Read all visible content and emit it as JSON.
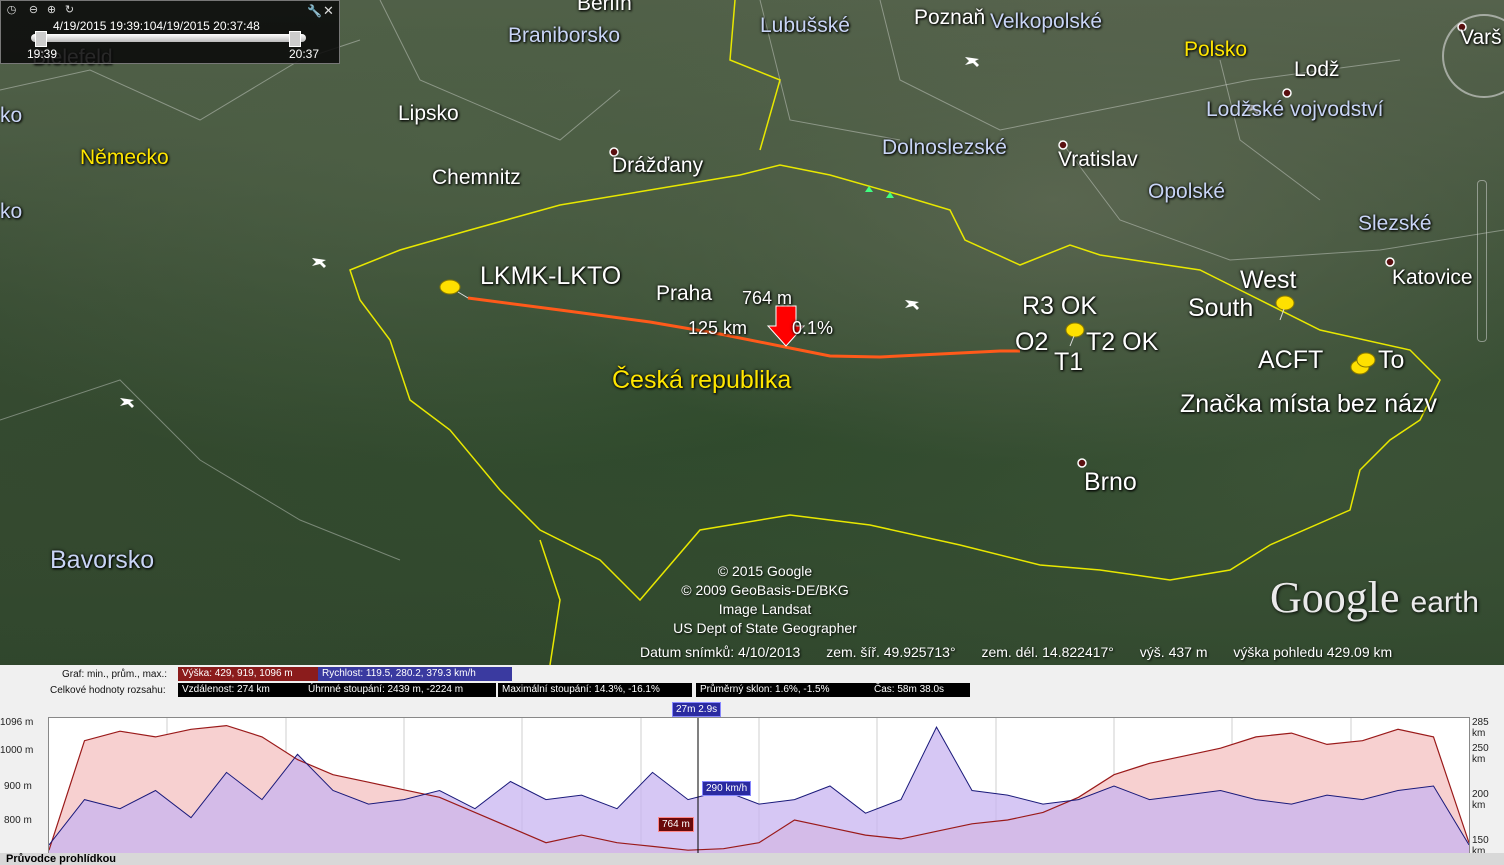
{
  "time_slider": {
    "range_label": "4/19/2015   19:39:104/19/2015   20:37:48",
    "start_time": "19:39",
    "end_time": "20:37"
  },
  "map": {
    "regions": [
      "Braniborsko",
      "Lubušské",
      "Velkopolské",
      "Dolnoslezské",
      "Opolské",
      "Lodžské vojvodství",
      "Slezské",
      "Bavorsko"
    ],
    "cities": [
      "Berlín",
      "Poznaň",
      "Lodž",
      "Varš",
      "Bielefeld",
      "Lipsko",
      "Chemnitz",
      "Drážďany",
      "Vratislav",
      "Katovice",
      "Brno",
      "Praha",
      "ko",
      "ko"
    ],
    "countries": [
      "Německo",
      "Polsko",
      "Česká republika"
    ],
    "placemarks": [
      "LKMK-LKTO",
      "R3 OK",
      "O2",
      "T1",
      "T2 OK",
      "West",
      "South",
      "ACFT",
      "To",
      "Značka místa bez názv"
    ],
    "cursor": {
      "elevation": "764 m",
      "distance": "125 km",
      "slope": "0.1%"
    },
    "attribution": [
      "© 2015 Google",
      "© 2009 GeoBasis-DE/BKG",
      "Image Landsat",
      "US Dept of State Geographer"
    ],
    "logo": {
      "google": "Google",
      "earth": "earth"
    },
    "status": {
      "imagery_date": "Datum snímků: 4/10/2013",
      "lat": "zem. šíř.   49.925713°",
      "lon": "zem. dél.   14.822417°",
      "elev": "výš.   437 m",
      "eye_alt": "výška pohledu 429.09 km"
    }
  },
  "profile": {
    "graph_label": "Graf: min., prům., max.:",
    "elevation_stats": "Výška: 429, 919, 1096 m",
    "speed_stats": "Rychlost: 119.5, 280.2, 379.3 km/h",
    "totals_label": "Celkové hodnoty rozsahu:",
    "distance": "Vzdálenost: 274 km",
    "total_climb": "Úhrnné stoupání: 2439 m, -2224 m",
    "max_slope": "Maximální stoupání: 14.3%, -16.1%",
    "avg_slope": "Průměrný sklon: 1.6%, -1.5%",
    "time": "Čas: 58m 38.0s",
    "cursor_time": "27m 2.9s",
    "cursor_speed": "290 km/h",
    "cursor_elev": "764 m",
    "y_left": [
      "1096 m",
      "1000 m",
      "900 m",
      "800 m"
    ],
    "y_right": [
      "285 km",
      "250 km",
      "200 km",
      "150 km"
    ],
    "guide_title": "Průvodce prohlídkou"
  },
  "colors": {
    "track": "#ff5a1a",
    "border": "#e8e800",
    "elevation_fill": "#f7d0d0",
    "elevation_line": "#9a1a1a",
    "speed_fill": "#d8c8f0",
    "speed_line": "#1a1a7a"
  },
  "chart_data": {
    "type": "area",
    "x_range": [
      0,
      274
    ],
    "series": [
      {
        "name": "Výška",
        "unit": "m",
        "ylim": [
          750,
          1110
        ],
        "values": [
          760,
          1050,
          1075,
          1060,
          1080,
          1090,
          1060,
          1000,
          960,
          940,
          920,
          900,
          860,
          820,
          780,
          800,
          780,
          770,
          760,
          764,
          780,
          840,
          820,
          800,
          790,
          810,
          830,
          840,
          860,
          900,
          960,
          990,
          1010,
          1030,
          1060,
          1070,
          1040,
          1050,
          1080,
          1060,
          780
        ]
      },
      {
        "name": "Rychlost",
        "unit": "km/h",
        "ylim": [
          140,
          290
        ],
        "values": [
          150,
          200,
          190,
          210,
          180,
          230,
          200,
          250,
          210,
          195,
          200,
          210,
          190,
          220,
          200,
          205,
          190,
          230,
          200,
          210,
          195,
          200,
          215,
          185,
          200,
          280,
          210,
          205,
          195,
          200,
          215,
          200,
          205,
          210,
          200,
          195,
          205,
          200,
          210,
          215,
          150
        ]
      }
    ]
  }
}
